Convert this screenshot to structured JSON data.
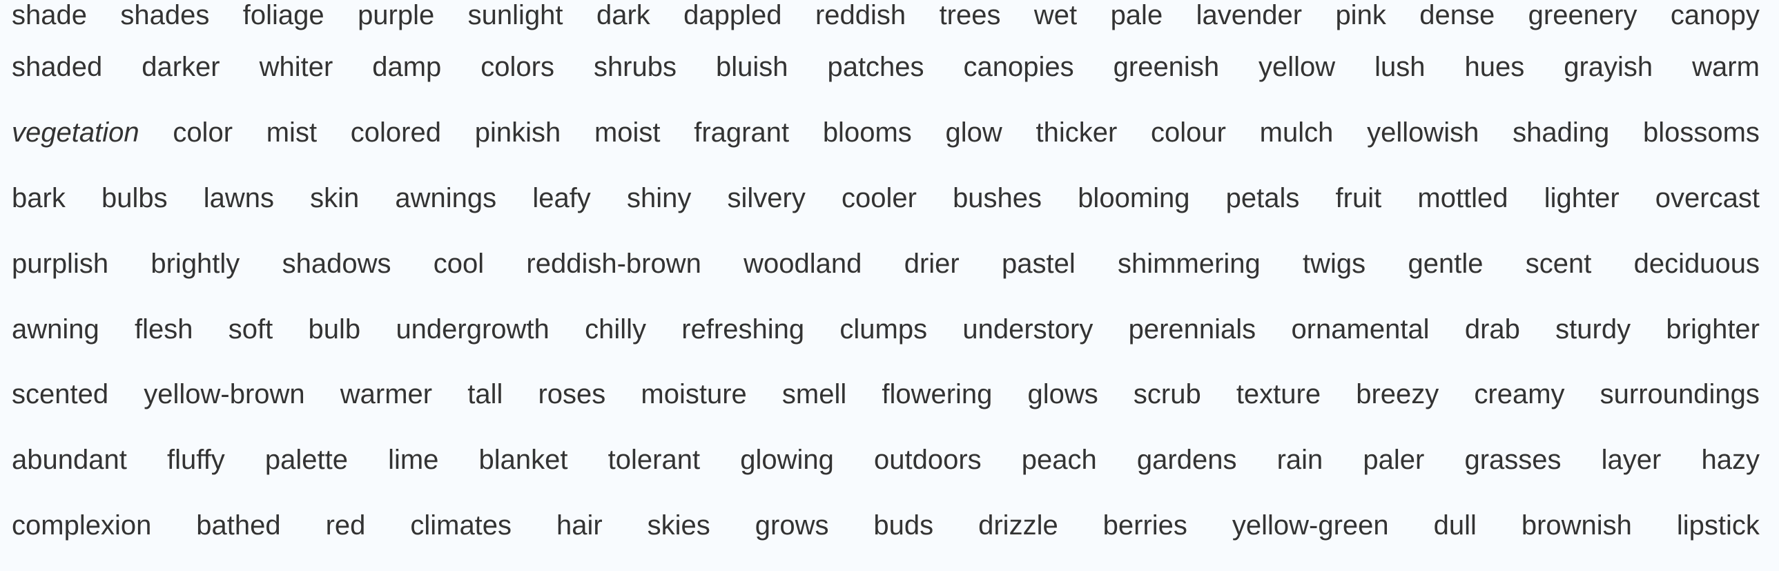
{
  "rows": [
    [
      "shade",
      "shades",
      "foliage",
      "purple",
      "sunlight",
      "dark",
      "dappled",
      "reddish",
      "trees",
      "wet",
      "pale",
      "lavender",
      "pink",
      "dense",
      "greenery",
      "canopy"
    ],
    [
      "shaded",
      "darker",
      "whiter",
      "damp",
      "colors",
      "shrubs",
      "bluish",
      "patches",
      "canopies",
      "greenish",
      "yellow",
      "lush",
      "hues",
      "grayish",
      "warm"
    ],
    [
      "vegetation",
      "color",
      "mist",
      "colored",
      "pinkish",
      "moist",
      "fragrant",
      "blooms",
      "glow",
      "thicker",
      "colour",
      "mulch",
      "yellowish",
      "shading",
      "blossoms"
    ],
    [
      "bark",
      "bulbs",
      "lawns",
      "skin",
      "awnings",
      "leafy",
      "shiny",
      "silvery",
      "cooler",
      "bushes",
      "blooming",
      "petals",
      "fruit",
      "mottled",
      "lighter",
      "overcast"
    ],
    [
      "purplish",
      "brightly",
      "shadows",
      "cool",
      "reddish-brown",
      "woodland",
      "drier",
      "pastel",
      "shimmering",
      "twigs",
      "gentle",
      "scent",
      "deciduous"
    ],
    [
      "awning",
      "flesh",
      "soft",
      "bulb",
      "undergrowth",
      "chilly",
      "refreshing",
      "clumps",
      "understory",
      "perennials",
      "ornamental",
      "drab",
      "sturdy",
      "brighter"
    ],
    [
      "scented",
      "yellow-brown",
      "warmer",
      "tall",
      "roses",
      "moisture",
      "smell",
      "flowering",
      "glows",
      "scrub",
      "texture",
      "breezy",
      "creamy",
      "surroundings"
    ],
    [
      "abundant",
      "fluffy",
      "palette",
      "lime",
      "blanket",
      "tolerant",
      "glowing",
      "outdoors",
      "peach",
      "gardens",
      "rain",
      "paler",
      "grasses",
      "layer",
      "hazy"
    ],
    [
      "complexion",
      "bathed",
      "red",
      "climates",
      "hair",
      "skies",
      "grows",
      "buds",
      "drizzle",
      "berries",
      "yellow-green",
      "dull",
      "brownish",
      "lipstick"
    ]
  ],
  "italic_words": [
    "vegetation"
  ],
  "colors": {
    "background": "#f8fbfe",
    "text": "#333333"
  }
}
